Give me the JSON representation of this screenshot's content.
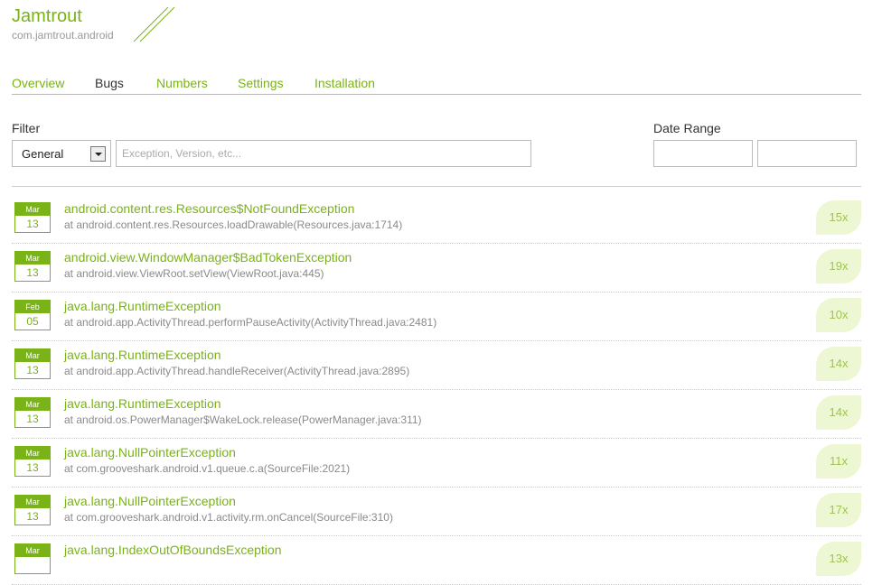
{
  "app": {
    "title": "Jamtrout",
    "package": "com.jamtrout.android"
  },
  "nav": {
    "tabs": [
      {
        "label": "Overview"
      },
      {
        "label": "Bugs"
      },
      {
        "label": "Numbers"
      },
      {
        "label": "Settings"
      },
      {
        "label": "Installation"
      }
    ],
    "active": "Bugs"
  },
  "filter": {
    "label": "Filter",
    "select_value": "General",
    "search_placeholder": "Exception, Version, etc..."
  },
  "date_range": {
    "label": "Date Range",
    "from": "",
    "to": ""
  },
  "colors": {
    "accent": "#7ab317",
    "count_bg": "#eef7d4",
    "count_text": "#9fc44f",
    "muted": "#8a8a8a"
  },
  "bugs": [
    {
      "month": "Mar",
      "day": "13",
      "title": "android.content.res.Resources$NotFoundException",
      "trace": "at android.content.res.Resources.loadDrawable(Resources.java:1714)",
      "count": "15x"
    },
    {
      "month": "Mar",
      "day": "13",
      "title": "android.view.WindowManager$BadTokenException",
      "trace": "at android.view.ViewRoot.setView(ViewRoot.java:445)",
      "count": "19x"
    },
    {
      "month": "Feb",
      "day": "05",
      "title": "java.lang.RuntimeException",
      "trace": "at android.app.ActivityThread.performPauseActivity(ActivityThread.java:2481)",
      "count": "10x"
    },
    {
      "month": "Mar",
      "day": "13",
      "title": "java.lang.RuntimeException",
      "trace": "at android.app.ActivityThread.handleReceiver(ActivityThread.java:2895)",
      "count": "14x"
    },
    {
      "month": "Mar",
      "day": "13",
      "title": "java.lang.RuntimeException",
      "trace": "at android.os.PowerManager$WakeLock.release(PowerManager.java:311)",
      "count": "14x"
    },
    {
      "month": "Mar",
      "day": "13",
      "title": "java.lang.NullPointerException",
      "trace": "at com.grooveshark.android.v1.queue.c.a(SourceFile:2021)",
      "count": "11x"
    },
    {
      "month": "Mar",
      "day": "13",
      "title": "java.lang.NullPointerException",
      "trace": "at com.grooveshark.android.v1.activity.rm.onCancel(SourceFile:310)",
      "count": "17x"
    },
    {
      "month": "Mar",
      "day": "",
      "title": "java.lang.IndexOutOfBoundsException",
      "trace": "",
      "count": "13x"
    }
  ]
}
